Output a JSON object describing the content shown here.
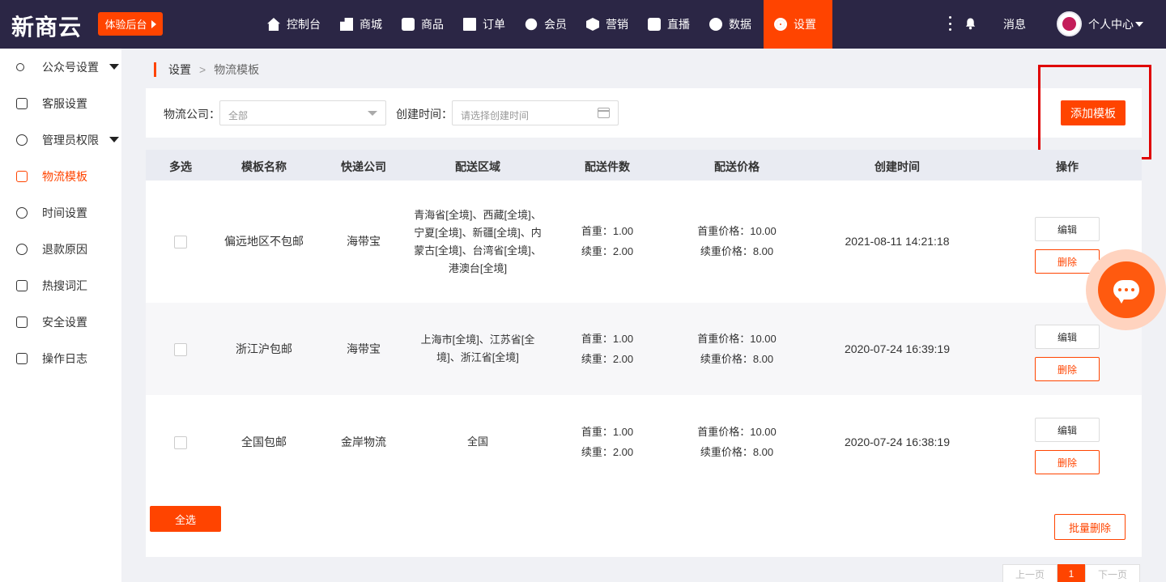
{
  "app": {
    "logo": "新商云",
    "trial_button": "体验后台"
  },
  "nav": [
    {
      "label": "控制台",
      "icon": "home-icon"
    },
    {
      "label": "商城",
      "icon": "shop-icon"
    },
    {
      "label": "商品",
      "icon": "goods-icon"
    },
    {
      "label": "订单",
      "icon": "order-icon"
    },
    {
      "label": "会员",
      "icon": "member-icon"
    },
    {
      "label": "营销",
      "icon": "cube-icon"
    },
    {
      "label": "直播",
      "icon": "live-icon"
    },
    {
      "label": "数据",
      "icon": "pie-chart-icon"
    },
    {
      "label": "设置",
      "icon": "gear-icon",
      "active": true
    }
  ],
  "header_right": {
    "message_label": "消息",
    "profile_label": "个人中心"
  },
  "sidebar": {
    "items": [
      {
        "label": "公众号设置",
        "icon": "link-icon",
        "has_caret": true
      },
      {
        "label": "客服设置",
        "icon": "service-icon"
      },
      {
        "label": "管理员权限",
        "icon": "admin-icon",
        "has_caret": true
      },
      {
        "label": "物流模板",
        "icon": "truck-icon",
        "active": true
      },
      {
        "label": "时间设置",
        "icon": "clock-icon"
      },
      {
        "label": "退款原因",
        "icon": "refund-icon"
      },
      {
        "label": "热搜词汇",
        "icon": "hot-search-icon"
      },
      {
        "label": "安全设置",
        "icon": "lock-icon"
      },
      {
        "label": "操作日志",
        "icon": "log-icon"
      }
    ]
  },
  "breadcrumb": {
    "level1": "设置",
    "separator": ">",
    "level2": "物流模板"
  },
  "filters": {
    "company_label": "物流公司：",
    "company_value": "全部",
    "date_label": "创建时间：",
    "date_placeholder": "请选择创建时间",
    "add_button": "添加模板"
  },
  "table": {
    "headers": [
      "多选",
      "模板名称",
      "快递公司",
      "配送区域",
      "配送件数",
      "配送价格",
      "创建时间",
      "操作"
    ],
    "rows": [
      {
        "name": "偏远地区不包邮",
        "company": "海带宝",
        "region": "青海省[全境]、西藏[全境]、宁夏[全境]、新疆[全境]、内蒙古[全境]、台湾省[全境]、港澳台[全境]",
        "first_weight": "首重：1.00",
        "extra_weight": "续重：2.00",
        "first_price": "首重价格：10.00",
        "extra_price": "续重价格：8.00",
        "created": "2021-08-11 14:21:18",
        "edit": "编辑",
        "delete": "删除"
      },
      {
        "name": "浙江沪包邮",
        "company": "海带宝",
        "region": "上海市[全境]、江苏省[全境]、浙江省[全境]",
        "first_weight": "首重：1.00",
        "extra_weight": "续重：2.00",
        "first_price": "首重价格：10.00",
        "extra_price": "续重价格：8.00",
        "created": "2020-07-24 16:39:19",
        "edit": "编辑",
        "delete": "删除"
      },
      {
        "name": "全国包邮",
        "company": "金岸物流",
        "region": "全国",
        "first_weight": "首重：1.00",
        "extra_weight": "续重：2.00",
        "first_price": "首重价格：10.00",
        "extra_price": "续重价格：8.00",
        "created": "2020-07-24 16:38:19",
        "edit": "编辑",
        "delete": "删除"
      }
    ],
    "select_all": "全选",
    "batch_delete": "批量删除"
  },
  "pagination": {
    "prev": "上一页",
    "current": "1",
    "next": "下一页"
  },
  "colors": {
    "accent": "#ff4400",
    "topbar": "#2b2645",
    "highlight": "#e00000"
  }
}
